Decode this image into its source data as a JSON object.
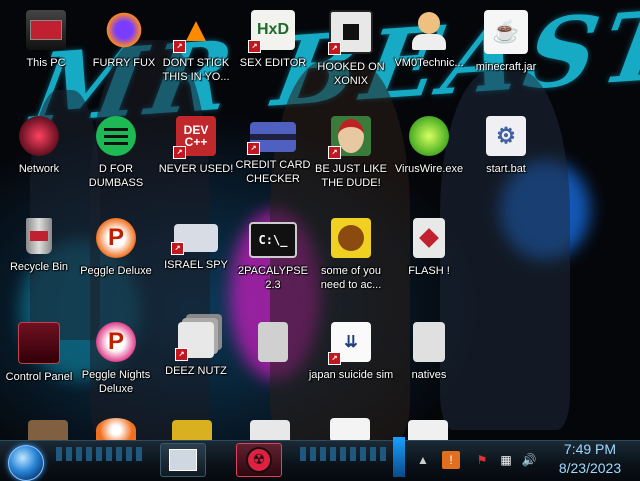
{
  "wallpaper": {
    "title": "MR BEAST"
  },
  "desktop_icons": [
    {
      "id": "this-pc",
      "label": "This PC"
    },
    {
      "id": "furry-fux",
      "label": "FURRY FUX"
    },
    {
      "id": "dont-stick",
      "label": "DONT STICK THIS IN YO..."
    },
    {
      "id": "sex-editor",
      "label": "SEX EDITOR"
    },
    {
      "id": "hooked-on-xonix",
      "label": "HOOKED ON XONIX"
    },
    {
      "id": "vm0technic",
      "label": "VM0Technic..."
    },
    {
      "id": "minecraft-jar",
      "label": "minecraft.jar"
    },
    {
      "id": "network",
      "label": "Network"
    },
    {
      "id": "d-for-dumbass",
      "label": "D FOR DUMBASS"
    },
    {
      "id": "never-used",
      "label": "NEVER USED!"
    },
    {
      "id": "credit-card-checker",
      "label": "CREDIT CARD CHECKER"
    },
    {
      "id": "be-just-like",
      "label": "BE JUST LIKE THE DUDE!"
    },
    {
      "id": "viruswire",
      "label": "VirusWire.exe"
    },
    {
      "id": "start-bat",
      "label": "start.bat"
    },
    {
      "id": "recycle-bin",
      "label": "Recycle Bin"
    },
    {
      "id": "peggle-deluxe",
      "label": "Peggle Deluxe"
    },
    {
      "id": "israel-spy",
      "label": "ISRAEL SPY"
    },
    {
      "id": "2pacalypse",
      "label": "2PACALYPSE 2.3"
    },
    {
      "id": "some-of-you",
      "label": "some of you need to ac..."
    },
    {
      "id": "flash",
      "label": "FLASH !"
    },
    {
      "id": "control-panel",
      "label": "Control Panel"
    },
    {
      "id": "peggle-nights",
      "label": "Peggle Nights Deluxe"
    },
    {
      "id": "deez-nutz",
      "label": "DEEZ NUTZ"
    },
    {
      "id": "japan-suicide",
      "label": "japan suicide sim"
    },
    {
      "id": "natives",
      "label": "natives"
    }
  ],
  "icon_glyphs": {
    "dont-stick": "▲",
    "never-used": "DEV\nC++",
    "sex-editor": "HxD",
    "2pacalypse": "C:\\_"
  },
  "taskbar": {
    "clock_time": "7:49 PM",
    "clock_date": "8/23/2023"
  },
  "colors": {
    "accent": "#19c7e6",
    "taskbar_text": "#9fd8ff"
  }
}
